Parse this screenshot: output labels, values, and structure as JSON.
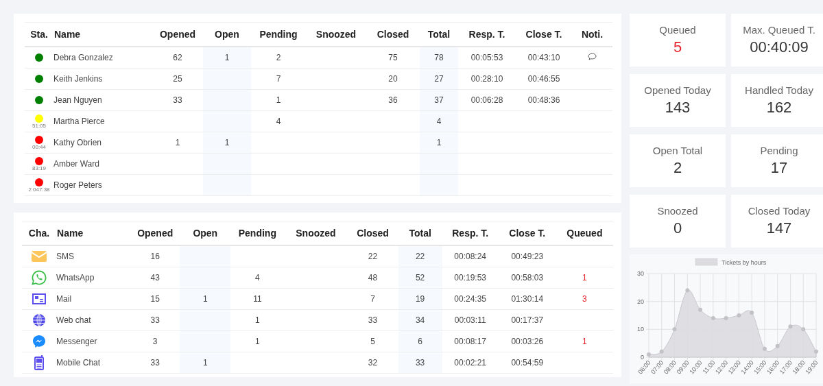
{
  "agents": {
    "columns": [
      "Sta.",
      "Name",
      "Opened",
      "Open",
      "Pending",
      "Snoozed",
      "Closed",
      "Total",
      "Resp. T.",
      "Close T.",
      "Noti."
    ],
    "rows": [
      {
        "status": {
          "color": "#008000"
        },
        "cells": [
          "",
          "Debra Gonzalez",
          "62",
          "1",
          "2",
          "",
          "75",
          "78",
          "00:05:53",
          "00:43:10",
          ""
        ],
        "notification": true
      },
      {
        "status": {
          "color": "#008000"
        },
        "cells": [
          "",
          "Keith Jenkins",
          "25",
          "",
          "7",
          "",
          "20",
          "27",
          "00:28:10",
          "00:46:55",
          ""
        ],
        "notification": false
      },
      {
        "status": {
          "color": "#008000"
        },
        "cells": [
          "",
          "Jean Nguyen",
          "33",
          "",
          "1",
          "",
          "36",
          "37",
          "00:06:28",
          "00:48:36",
          ""
        ],
        "notification": false
      },
      {
        "status": {
          "color": "#ffff00",
          "timer": "51:05"
        },
        "cells": [
          "",
          "Martha Pierce",
          "",
          "",
          "4",
          "",
          "",
          "4",
          "",
          "",
          ""
        ],
        "notification": false
      },
      {
        "status": {
          "color": "#ff0000",
          "timer": "00:44"
        },
        "cells": [
          "",
          "Kathy Obrien",
          "1",
          "1",
          "",
          "",
          "",
          "1",
          "",
          "",
          ""
        ],
        "notification": false
      },
      {
        "status": {
          "color": "#ff0000",
          "timer": "83:19"
        },
        "cells": [
          "",
          "Amber Ward",
          "",
          "",
          "",
          "",
          "",
          "",
          "",
          "",
          ""
        ],
        "notification": false
      },
      {
        "status": {
          "color": "#ff0000",
          "timer": "2 047:38"
        },
        "cells": [
          "",
          "Roger Peters",
          "",
          "",
          "",
          "",
          "",
          "",
          "",
          "",
          ""
        ],
        "notification": false
      }
    ]
  },
  "channels": {
    "columns": [
      "Cha.",
      "Name",
      "Opened",
      "Open",
      "Pending",
      "Snoozed",
      "Closed",
      "Total",
      "Resp. T.",
      "Close T.",
      "Queued"
    ],
    "rows": [
      {
        "kind": "sms",
        "cells": [
          "",
          "SMS",
          "16",
          "",
          "",
          "",
          "22",
          "22",
          "00:08:24",
          "00:49:23",
          ""
        ]
      },
      {
        "kind": "whatsapp",
        "cells": [
          "",
          "WhatsApp",
          "43",
          "",
          "4",
          "",
          "48",
          "52",
          "00:19:53",
          "00:58:03",
          "1"
        ]
      },
      {
        "kind": "mail",
        "cells": [
          "",
          "Mail",
          "15",
          "1",
          "11",
          "",
          "7",
          "19",
          "00:24:35",
          "01:30:14",
          "3"
        ]
      },
      {
        "kind": "webchat",
        "cells": [
          "",
          "Web chat",
          "33",
          "",
          "1",
          "",
          "33",
          "34",
          "00:03:11",
          "00:17:37",
          ""
        ]
      },
      {
        "kind": "messenger",
        "cells": [
          "",
          "Messenger",
          "3",
          "",
          "1",
          "",
          "5",
          "6",
          "00:08:17",
          "00:03:26",
          "1"
        ]
      },
      {
        "kind": "mobile",
        "cells": [
          "",
          "Mobile Chat",
          "33",
          "1",
          "",
          "",
          "32",
          "33",
          "00:02:21",
          "00:54:59",
          ""
        ]
      }
    ]
  },
  "stats": [
    {
      "label": "Queued",
      "value": "5",
      "alert": true
    },
    {
      "label": "Max. Queued T.",
      "value": "00:40:09",
      "alert": false
    },
    {
      "label": "Opened Today",
      "value": "143",
      "alert": false
    },
    {
      "label": "Handled Today",
      "value": "162",
      "alert": false
    },
    {
      "label": "Open Total",
      "value": "2",
      "alert": false
    },
    {
      "label": "Pending",
      "value": "17",
      "alert": false
    },
    {
      "label": "Snoozed",
      "value": "0",
      "alert": false
    },
    {
      "label": "Closed Today",
      "value": "147",
      "alert": false
    }
  ],
  "chart": {
    "chart_data": {
      "type": "area",
      "categories": [
        "06:00",
        "07:00",
        "08:00",
        "09:00",
        "10:00",
        "11:00",
        "12:00",
        "13:00",
        "14:00",
        "15:00",
        "16:00",
        "17:00",
        "18:00",
        "19:00"
      ],
      "series": [
        {
          "name": "Tickets by hours",
          "color": "#dcdbe0",
          "values": [
            1,
            2,
            10,
            24,
            17,
            14,
            14,
            15,
            16,
            3,
            4,
            11,
            10,
            2
          ]
        }
      ],
      "ylim": [
        0,
        30
      ],
      "yticks": [
        0,
        10,
        20,
        30
      ]
    }
  }
}
